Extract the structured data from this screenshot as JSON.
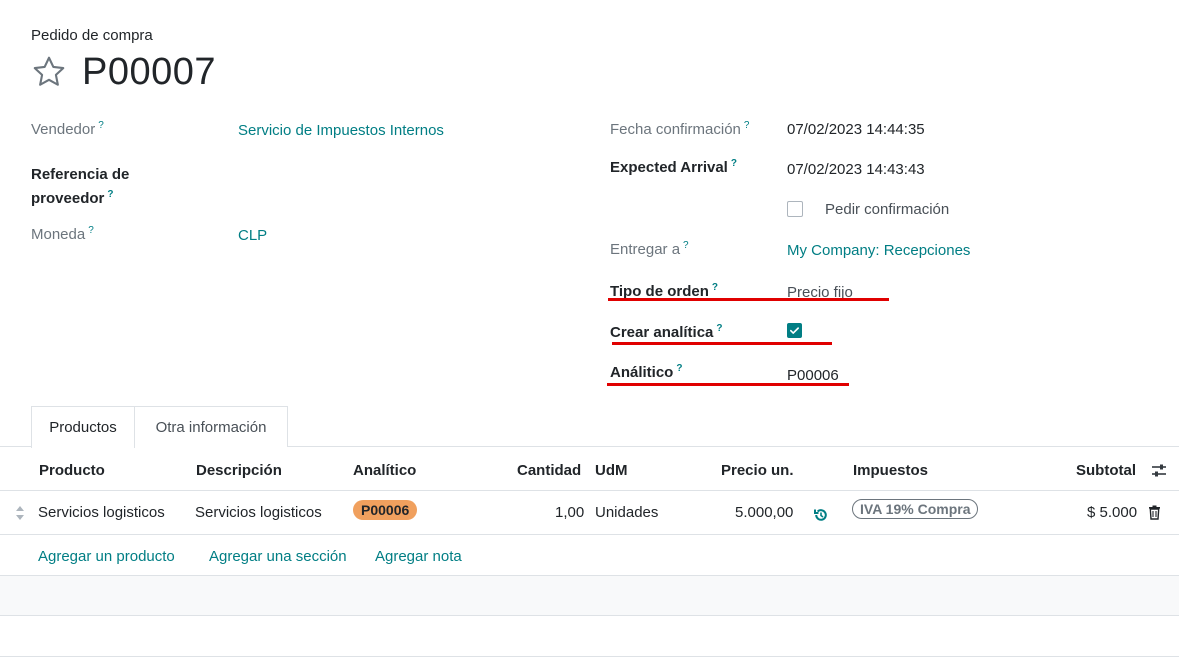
{
  "header": {
    "doc_type": "Pedido de compra",
    "title": "P00007"
  },
  "left_fields": {
    "vendedor": {
      "label": "Vendedor",
      "help": "?",
      "value": "Servicio de Impuestos Internos"
    },
    "referencia": {
      "label_line1": "Referencia de",
      "label_line2": "proveedor",
      "help": "?"
    },
    "moneda": {
      "label": "Moneda",
      "help": "?",
      "value": "CLP"
    }
  },
  "right_fields": {
    "fecha_confirmacion": {
      "label": "Fecha confirmación",
      "help": "?",
      "value": "07/02/2023 14:44:35"
    },
    "expected_arrival": {
      "label": "Expected Arrival",
      "help": "?",
      "value": "07/02/2023 14:43:43"
    },
    "pedir_confirmacion": {
      "label": "Pedir confirmación",
      "checked": false
    },
    "entregar_a": {
      "label": "Entregar a",
      "help": "?",
      "value": "My Company: Recepciones"
    },
    "tipo_orden": {
      "label": "Tipo de orden",
      "help": "?",
      "value": "Precio fijo"
    },
    "crear_analitica": {
      "label": "Crear analítica",
      "help": "?",
      "checked": true
    },
    "analitico": {
      "label": "Análitico",
      "help": "?",
      "value": "P00006"
    }
  },
  "tabs": [
    {
      "label": "Productos",
      "active": true
    },
    {
      "label": "Otra información",
      "active": false
    }
  ],
  "table": {
    "columns": [
      "Producto",
      "Descripción",
      "Analítico",
      "Cantidad",
      "UdM",
      "Precio un.",
      "Impuestos",
      "Subtotal"
    ],
    "rows": [
      {
        "producto": "Servicios logisticos",
        "descripcion": "Servicios logisticos",
        "analitico": "P00006",
        "cantidad": "1,00",
        "udm": "Unidades",
        "precio": "5.000,00",
        "impuestos": "IVA 19% Compra",
        "subtotal": "$ 5.000"
      }
    ],
    "add_links": [
      "Agregar un producto",
      "Agregar una sección",
      "Agregar nota"
    ]
  },
  "colors": {
    "accent": "#017e84",
    "highlight": "#e00000",
    "badge": "#f0a05e"
  }
}
